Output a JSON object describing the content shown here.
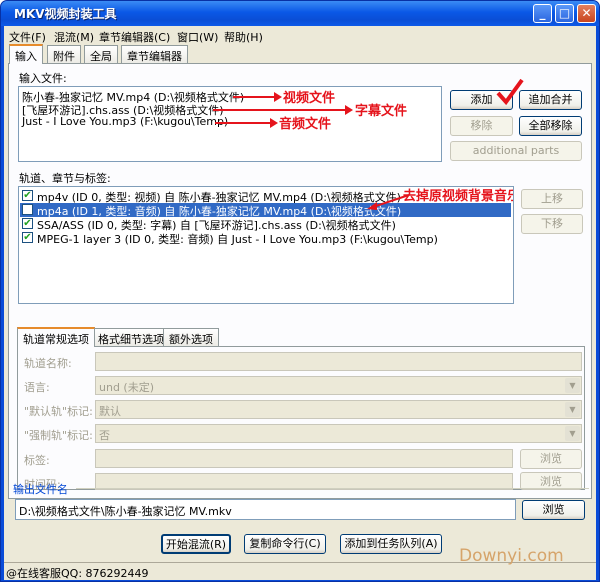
{
  "window": {
    "title": "MKV视频封装工具",
    "icon": "app-icon",
    "controls": {
      "minimize": "_",
      "maximize": "□",
      "close": "✕"
    }
  },
  "menu": [
    "文件(F)",
    "混流(M)",
    "章节编辑器(C)",
    "窗口(W)",
    "帮助(H)"
  ],
  "tabs": [
    "输入",
    "附件",
    "全局",
    "章节编辑器"
  ],
  "input_files": {
    "label": "输入文件:",
    "items": [
      "陈小春-独家记忆 MV.mp4 (D:\\视频格式文件)",
      "[飞屋环游记].chs.ass (D:\\视频格式文件)",
      "Just - I Love You.mp3 (F:\\kugou\\Temp)"
    ],
    "buttons": {
      "add": "添加",
      "append": "追加合并",
      "remove": "移除",
      "remove_all": "全部移除",
      "additional_parts": "additional parts"
    }
  },
  "annotations": {
    "video": "视频文件",
    "subtitle": "字幕文件",
    "audio": "音频文件",
    "remove_bg_music": "去掉原视频背景音乐",
    "color": "#e5141c"
  },
  "tracks": {
    "label": "轨道、章节与标签:",
    "items": [
      {
        "checked": true,
        "text": "mp4v (ID 0, 类型: 视频) 自 陈小春-独家记忆 MV.mp4 (D:\\视频格式文件)"
      },
      {
        "checked": false,
        "text": "mp4a (ID 1, 类型: 音频) 自 陈小春-独家记忆 MV.mp4 (D:\\视频格式文件)"
      },
      {
        "checked": true,
        "text": "SSA/ASS (ID 0, 类型: 字幕) 自 [飞屋环游记].chs.ass (D:\\视频格式文件)"
      },
      {
        "checked": true,
        "text": "MPEG-1 layer 3 (ID 0, 类型: 音频) 自 Just - I Love You.mp3 (F:\\kugou\\Temp)"
      }
    ],
    "buttons": {
      "up": "上移",
      "down": "下移"
    },
    "selected_index": 1
  },
  "track_options": {
    "tabs": [
      "轨道常规选项",
      "格式细节选项",
      "额外选项"
    ],
    "fields": {
      "name_label": "轨道名称:",
      "language_label": "语言:",
      "language_value": "und (未定)",
      "default_label": "\"默认轨\"标记:",
      "default_value": "默认",
      "forced_label": "\"强制轨\"标记:",
      "forced_value": "否",
      "tags_label": "标签:",
      "timecode_label": "时间码:",
      "browse": "浏览"
    }
  },
  "output": {
    "label": "输出文件名",
    "value": "D:\\视频格式文件\\陈小春-独家记忆 MV.mkv",
    "browse": "浏览"
  },
  "actions": {
    "start_mux": "开始混流(R)",
    "copy_cmd": "复制命令行(C)",
    "add_queue": "添加到任务队列(A)"
  },
  "status": {
    "text": "@在线客服QQ: 876292449",
    "watermark": "Downyi.com"
  }
}
